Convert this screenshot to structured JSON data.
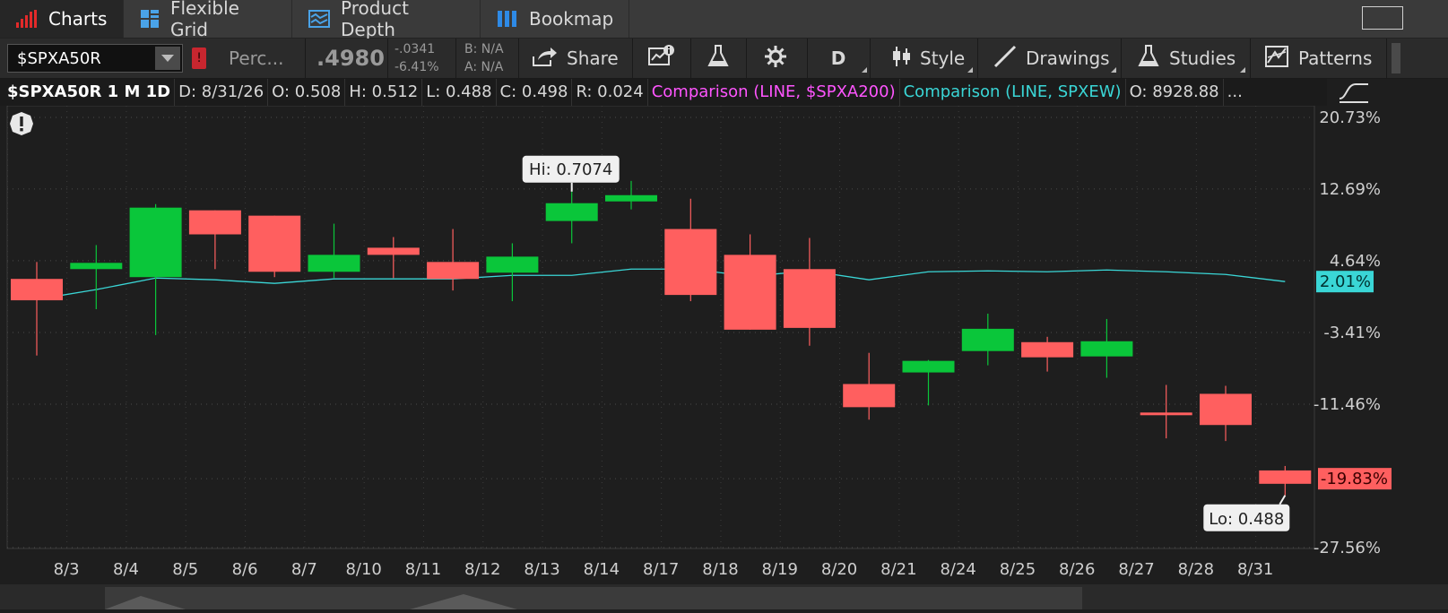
{
  "tabs": [
    {
      "label": "Charts",
      "icon": "bar-chart-icon",
      "active": true
    },
    {
      "label": "Flexible Grid",
      "icon": "grid-icon",
      "active": false
    },
    {
      "label": "Product Depth",
      "icon": "product-depth-icon",
      "active": false
    },
    {
      "label": "Bookmap",
      "icon": "bookmap-icon",
      "active": false
    }
  ],
  "toolbar": {
    "symbol": "$SPXA50R",
    "alert_badge": "!",
    "field_label": "Perc...",
    "last_price": ".4980",
    "net_change": "-.0341",
    "pct_change": "-6.41%",
    "bid": "B: N/A",
    "ask": "A: N/A",
    "share_label": "Share",
    "period_label": "D",
    "style_label": "Style",
    "drawings_label": "Drawings",
    "studies_label": "Studies",
    "patterns_label": "Patterns"
  },
  "infobar": {
    "title": "$SPXA50R 1 M 1D",
    "date": "D: 8/31/26",
    "open": "O: 0.508",
    "high": "H: 0.512",
    "low": "L: 0.488",
    "close": "C: 0.498",
    "range": "R: 0.024",
    "comparison1": "Comparison (LINE, $SPXA200)",
    "comparison2": "Comparison (LINE, SPXEW)",
    "comp_open": "O: 8928.88",
    "ellipsis": "..."
  },
  "colors": {
    "up": "#0ac63a",
    "down": "#ff5f5f",
    "comparison1": "#ff55ff",
    "comparison2": "#3ad6d6",
    "background": "#1e1e1e"
  },
  "chart_data": {
    "type": "candlestick",
    "y_axis_scale": "percent",
    "ylim": [
      -27.56,
      24.0
    ],
    "y_ticks": [
      20.73,
      12.69,
      4.64,
      -3.41,
      -11.46,
      -19.83,
      -27.56
    ],
    "y_tick_labels": [
      "20.73%",
      "12.69%",
      "4.64%",
      "-3.41%",
      "-11.46%",
      "-19.83%",
      "-27.56%"
    ],
    "current_value_label": "-19.83%",
    "comparison_value_label": "2.01%",
    "x_labels": [
      "8/3",
      "8/4",
      "8/5",
      "8/6",
      "8/7",
      "8/10",
      "8/11",
      "8/12",
      "8/13",
      "8/14",
      "8/17",
      "8/18",
      "8/19",
      "8/20",
      "8/21",
      "8/24",
      "8/25",
      "8/26",
      "8/27",
      "8/28",
      "8/31"
    ],
    "candles": [
      {
        "date": "8/3",
        "o": 2.6,
        "h": 4.5,
        "l": -6.0,
        "c": 0.2
      },
      {
        "date": "8/3b",
        "o": 3.7,
        "h": 6.4,
        "l": -0.8,
        "c": 4.4
      },
      {
        "date": "8/4",
        "o": 2.8,
        "h": 11.0,
        "l": -3.7,
        "c": 10.6
      },
      {
        "date": "8/5",
        "o": 10.3,
        "h": 10.3,
        "l": 3.7,
        "c": 7.6
      },
      {
        "date": "8/6",
        "o": 9.7,
        "h": 9.7,
        "l": 2.8,
        "c": 3.4
      },
      {
        "date": "8/7",
        "o": 3.4,
        "h": 8.8,
        "l": 2.7,
        "c": 5.3
      },
      {
        "date": "8/10",
        "o": 6.1,
        "h": 7.3,
        "l": 2.7,
        "c": 5.3
      },
      {
        "date": "8/11",
        "o": 4.5,
        "h": 8.2,
        "l": 1.3,
        "c": 2.6
      },
      {
        "date": "8/12",
        "o": 3.3,
        "h": 6.6,
        "l": 0.1,
        "c": 5.1
      },
      {
        "date": "8/13",
        "o": 9.1,
        "h": 12.4,
        "l": 6.6,
        "c": 11.1
      },
      {
        "date": "8/14",
        "o": 11.3,
        "h": 13.6,
        "l": 10.4,
        "c": 12.0
      },
      {
        "date": "8/17",
        "o": 8.2,
        "h": 11.6,
        "l": 0.1,
        "c": 0.8
      },
      {
        "date": "8/18",
        "o": 5.3,
        "h": 7.6,
        "l": -3.1,
        "c": -3.1
      },
      {
        "date": "8/19",
        "o": 3.7,
        "h": 7.2,
        "l": -4.9,
        "c": -2.9
      },
      {
        "date": "8/20",
        "o": -9.2,
        "h": -5.7,
        "l": -13.2,
        "c": -11.8
      },
      {
        "date": "8/21",
        "o": -7.9,
        "h": -6.5,
        "l": -11.6,
        "c": -6.6
      },
      {
        "date": "8/24",
        "o": -5.5,
        "h": -1.3,
        "l": -7.1,
        "c": -3.0
      },
      {
        "date": "8/25",
        "o": -4.5,
        "h": -3.9,
        "l": -7.8,
        "c": -6.2
      },
      {
        "date": "8/26",
        "o": -6.1,
        "h": -1.9,
        "l": -8.5,
        "c": -4.4
      },
      {
        "date": "8/27",
        "o": -12.4,
        "h": -9.3,
        "l": -15.3,
        "c": -12.7
      },
      {
        "date": "8/28",
        "o": -10.3,
        "h": -9.4,
        "l": -15.6,
        "c": -13.8
      },
      {
        "date": "8/31",
        "o": -18.9,
        "h": -18.4,
        "l": -21.7,
        "c": -20.4
      }
    ],
    "comparison_line": [
      0.3,
      1.4,
      2.7,
      2.5,
      2.1,
      2.6,
      2.6,
      2.6,
      3.0,
      3.0,
      3.7,
      3.7,
      2.9,
      3.5,
      2.5,
      3.4,
      3.5,
      3.4,
      3.6,
      3.4,
      3.1,
      2.3
    ],
    "annotations": {
      "hi_label": "Hi: 0.7074",
      "lo_label": "Lo: 0.488"
    }
  }
}
